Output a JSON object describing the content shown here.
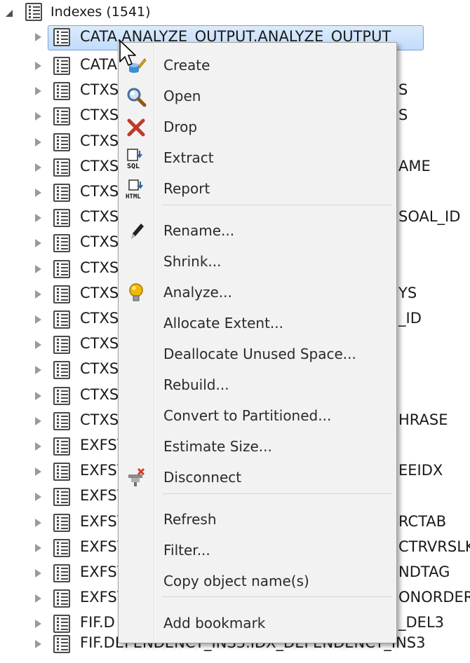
{
  "tree": {
    "root": {
      "label": "Indexes (1541)",
      "expanded": true
    },
    "selected_item": "CATA.ANALYZE_OUTPUT.ANALYZE_OUTPUT",
    "rows": [
      {
        "left": "CATA",
        "right": ""
      },
      {
        "left": "CTXS",
        "right": "S"
      },
      {
        "left": "CTXS",
        "right": "S"
      },
      {
        "left": "CTXS",
        "right": ""
      },
      {
        "left": "CTXS",
        "right": "AME"
      },
      {
        "left": "CTXS",
        "right": ""
      },
      {
        "left": "CTXS",
        "right": "SOAL_ID"
      },
      {
        "left": "CTXS",
        "right": ""
      },
      {
        "left": "CTXS",
        "right": ""
      },
      {
        "left": "CTXS",
        "right": "YS"
      },
      {
        "left": "CTXS",
        "right": "_ID"
      },
      {
        "left": "CTXS",
        "right": ""
      },
      {
        "left": "CTXS",
        "right": ""
      },
      {
        "left": "CTXS",
        "right": ""
      },
      {
        "left": "CTXS",
        "right": "HRASE"
      },
      {
        "left": "EXFSY",
        "right": ""
      },
      {
        "left": "EXFSY",
        "right": "EEIDX"
      },
      {
        "left": "EXFSY",
        "right": ""
      },
      {
        "left": "EXFSY",
        "right": "RCTAB"
      },
      {
        "left": "EXFSY",
        "right": "CTRVRSLK"
      },
      {
        "left": "EXFSY",
        "right": "NDTAG"
      },
      {
        "left": "EXFSY",
        "right": "ONORDER"
      },
      {
        "left": "FIF.D",
        "right": "_DEL3"
      }
    ],
    "last_row": "FIF.DEPENDENCY_INS3.IDX_DEPENDENCY_INS3"
  },
  "context_menu": {
    "items": [
      {
        "label": "Create",
        "icon": "create-icon"
      },
      {
        "label": "Open",
        "icon": "open-icon"
      },
      {
        "label": "Drop",
        "icon": "drop-icon"
      },
      {
        "label": "Extract",
        "icon": "extract-sql-icon"
      },
      {
        "label": "Report",
        "icon": "report-html-icon"
      },
      {
        "label": "Rename...",
        "icon": "rename-pencil-icon"
      },
      {
        "label": "Shrink...",
        "icon": ""
      },
      {
        "label": "Analyze...",
        "icon": "analyze-bulb-icon"
      },
      {
        "label": "Allocate Extent...",
        "icon": ""
      },
      {
        "label": "Deallocate Unused Space...",
        "icon": ""
      },
      {
        "label": "Rebuild...",
        "icon": ""
      },
      {
        "label": "Convert to Partitioned...",
        "icon": ""
      },
      {
        "label": "Estimate Size...",
        "icon": ""
      },
      {
        "label": "Disconnect",
        "icon": "disconnect-icon"
      },
      {
        "label": "Refresh",
        "icon": ""
      },
      {
        "label": "Filter...",
        "icon": ""
      },
      {
        "label": "Copy object name(s)",
        "icon": ""
      },
      {
        "label": "Add bookmark",
        "icon": ""
      }
    ]
  },
  "colors": {
    "selection_fill": "#c1dcfc",
    "selection_border": "#7da2ce",
    "menu_background": "#f2f2f2",
    "drop_red": "#c0392b",
    "analyze_yellow": "#f2b900"
  }
}
